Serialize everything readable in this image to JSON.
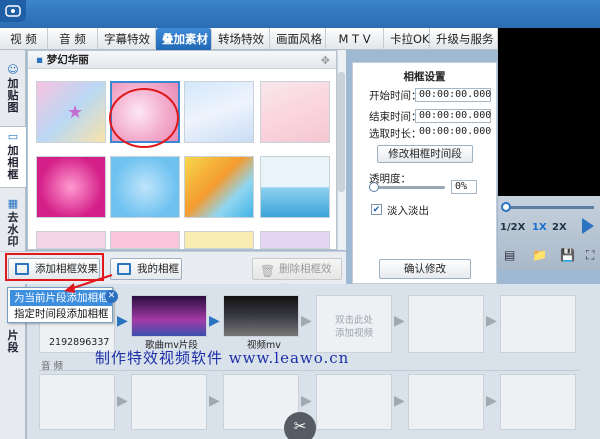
{
  "tabs": [
    "视 频",
    "音 频",
    "字幕特效",
    "叠加素材",
    "转场特效",
    "画面风格",
    "M T V",
    "卡拉OK",
    "升级与服务"
  ],
  "active_tab": "叠加素材",
  "side_tabs": {
    "add_sticker": "加贴图",
    "add_frame": "加相框",
    "remove_watermark": "去水印",
    "clips": "片段"
  },
  "gallery": {
    "category": "梦幻华丽",
    "add_frame_button": "添加相框效果",
    "my_frames_button": "我的相框",
    "delete_frame_button": "删除相框效果"
  },
  "settings": {
    "title": "相框设置",
    "start_label": "开始时间：",
    "start_value": "00:00:00.000",
    "end_label": "结束时间：",
    "end_value": "00:00:00.000",
    "duration_label": "选取时长：",
    "duration_value": "00:00:00.000",
    "modify_time_button": "修改相框时间段",
    "opacity_label": "透明度：",
    "opacity_value": "0%",
    "fade_label": "淡入淡出",
    "fade_checked": true,
    "confirm_button": "确认修改"
  },
  "popup": {
    "item1": "为当前片段添加相框",
    "item2": "指定时间段添加相框"
  },
  "timeline": {
    "clip1_label": "2192896337",
    "clip2_label": "歌曲mv片段",
    "clip3_label": "视频mv",
    "empty_hint_line1": "双击此处",
    "empty_hint_line2": "添加视频",
    "audio_label": "音 频"
  },
  "player": {
    "speed_half": "1/2X",
    "speed_1": "1X",
    "speed_2": "2X"
  },
  "watermark_text": "制作特效视频软件 www.leawo.cn",
  "colors": {
    "accent": "#2a74c0",
    "annotation": "#e0171b"
  }
}
